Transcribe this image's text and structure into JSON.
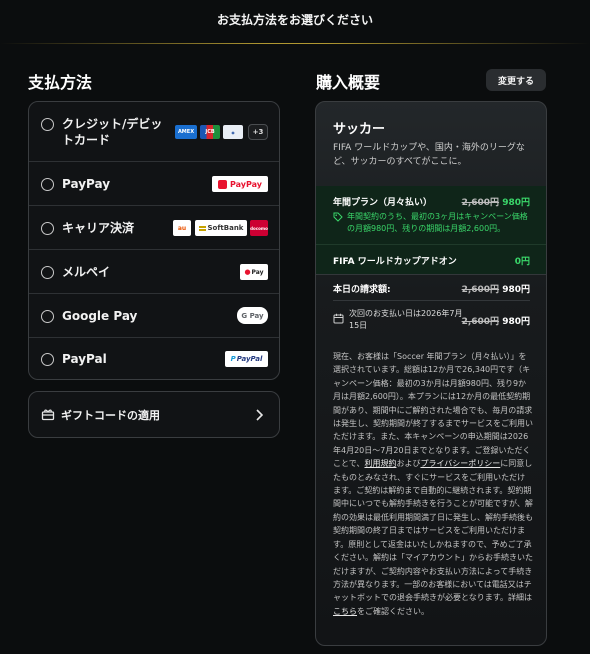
{
  "header": {
    "title": "お支払方法をお選びください"
  },
  "payment": {
    "heading": "支払方法",
    "methods": [
      {
        "label": "クレジット/デビットカード",
        "more": "+3"
      },
      {
        "label": "PayPay",
        "logo": "PayPay"
      },
      {
        "label": "キャリア決済",
        "logos": [
          "au",
          "SoftBank",
          "docomo"
        ]
      },
      {
        "label": "メルペイ",
        "logo": "Pay"
      },
      {
        "label": "Google Pay",
        "logo": "G Pay"
      },
      {
        "label": "PayPal",
        "logo": "PayPal"
      }
    ],
    "gift": "ギフトコードの適用"
  },
  "summary": {
    "heading": "購入概要",
    "change_label": "変更する",
    "product_title": "サッカー",
    "product_desc": "FIFA ワールドカップや、国内・海外のリーグなど、サッカーのすべてがここに。",
    "plan_name": "年間プラン（月々払い）",
    "plan_old_price": "2,600円",
    "plan_price": "980円",
    "plan_note": "年間契約のうち、最初の3ヶ月はキャンペーン価格の月額980円、残りの期間は月額2,600円。",
    "addon_name": "FIFA ワールドカップアドオン",
    "addon_price": "0円",
    "today_label": "本日の請求額:",
    "today_old_price": "2,600円",
    "today_price": "980円",
    "next_label": "次回のお支払い日は2026年7月15日",
    "next_old_price": "2,600円",
    "next_price": "980円",
    "legal_1": "現在、お客様は「Soccer 年間プラン（月々払い）」を選択されています。総額は12か月で26,340円です（キャンペーン価格：最初の3か月は月額980円、残り9か月は月額2,600円）。本プランには12か月の最低契約期間があり、期間中にご解約された場合でも、毎月の請求は発生し、契約期間が終了するまでサービスをご利用いただけます。また、本キャンペーンの申込期間は2026年4月20日〜7月20日までとなります。ご登録いただくことで、",
    "terms_link": "利用規約",
    "legal_and": "および",
    "privacy_link": "プライバシーポリシー",
    "legal_2": "に同意したものとみなされ、すぐにサービスをご利用いただけます。ご契約は解約まで自動的に継続されます。契約期間中にいつでも解約手続きを行うことが可能ですが、解約の効果は最低利用期間満了日に発生し、解約手続後も契約期間の終了日まではサービスをご利用いただけます。原則として返金はいたしかねますので、予めご了承ください。解約は「マイアカウント」からお手続きいただけますが、ご契約内容やお支払い方法によって手続き方法が異なります。一部のお客様においては電話又はチャットボットでの退会手続きが必要となります。詳細は",
    "here_link": "こちら",
    "legal_3": "をご確認ください。"
  }
}
